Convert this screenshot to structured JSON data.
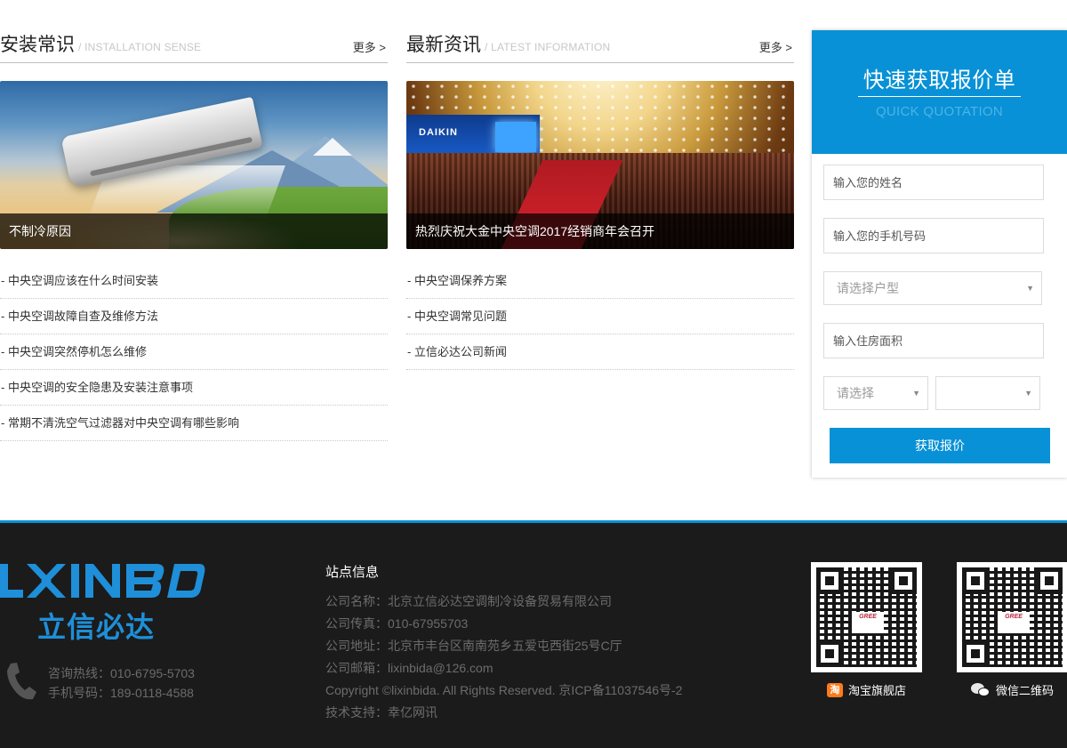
{
  "installation": {
    "title": "安装常识",
    "subtitle": "/ INSTALLATION SENSE",
    "more": "更多 >",
    "feature_caption": "不制冷原因",
    "items": [
      "- 中央空调应该在什么时间安装",
      "- 中央空调故障自查及维修方法",
      "- 中央空调突然停机怎么维修",
      "- 中央空调的安全隐患及安装注意事项",
      "- 常期不清洗空气过滤器对中央空调有哪些影响"
    ]
  },
  "news": {
    "title": "最新资讯",
    "subtitle": "/ LATEST INFORMATION",
    "more": "更多 >",
    "feature_caption": "热烈庆祝大金中央空调2017经销商年会召开",
    "stage_logo": "DAIKIN",
    "items": [
      "- 中央空调保养方案",
      "- 中央空调常见问题",
      "- 立信必达公司新闻"
    ]
  },
  "quote": {
    "title": "快速获取报价单",
    "subtitle": "QUICK QUOTATION",
    "name_placeholder": "输入您的姓名",
    "phone_placeholder": "输入您的手机号码",
    "house_type_select": "请选择户型",
    "area_placeholder": "输入住房面积",
    "option_select": "请选择",
    "option_select_2": "",
    "submit_label": "获取报价",
    "accent_color": "#0891d6"
  },
  "footer": {
    "logo_en": "LXINBD",
    "logo_cn": "立信必达",
    "hotline": "咨询热线：010-6795-5703",
    "mobile": "手机号码：189-0118-4588",
    "site_info_title": "站点信息",
    "site_info": [
      "公司名称：北京立信必达空调制冷设备贸易有限公司",
      "公司传真：010-67955703",
      "公司地址：北京市丰台区南南苑乡五爱屯西街25号C厅",
      "公司邮箱：lixinbida@126.com",
      "Copyright ©lixinbida. All Rights Reserved. 京ICP备11037546号-2",
      "技术支持：幸亿网讯"
    ],
    "qr_brand": "GREE",
    "taobao_label": "淘宝旗舰店",
    "wechat_label": "微信二维码",
    "taobao_icon_glyph": "淘"
  }
}
